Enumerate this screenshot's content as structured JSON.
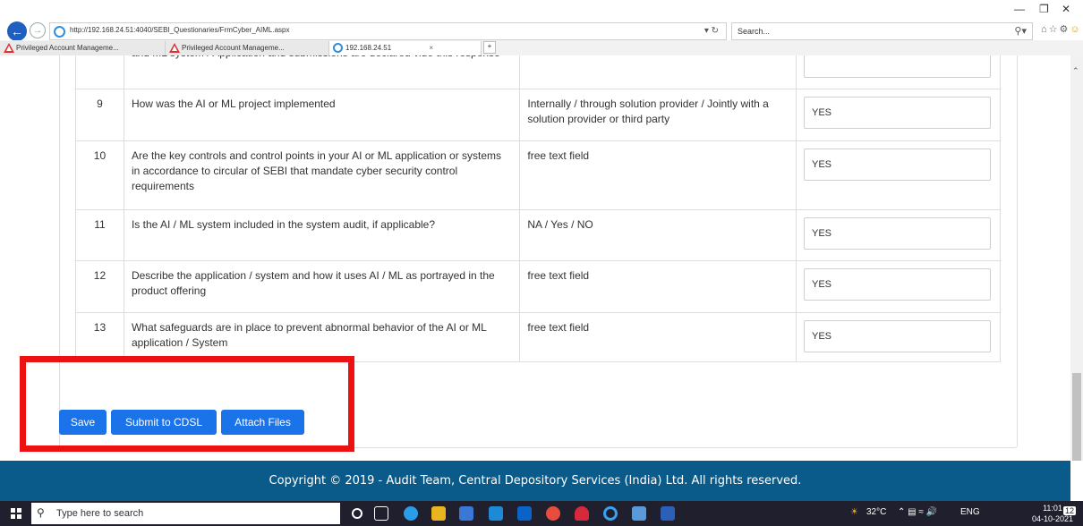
{
  "browser": {
    "url": "http://192.168.24.51:4040/SEBI_Questionaries/FrmCyber_AIML.aspx",
    "search_placeholder": "Search...",
    "tabs": [
      {
        "label": "Privileged Account Manageme..."
      },
      {
        "label": "Privileged Account Manageme..."
      },
      {
        "label": "192.168.24.51"
      }
    ]
  },
  "table": {
    "rows": [
      {
        "num": "",
        "question": "and ML system / Application and submissions are declared vide this response",
        "options": "",
        "answer": ""
      },
      {
        "num": "9",
        "question": "How was the AI or ML project implemented",
        "options": "Internally / through solution provider / Jointly with a solution provider or third party",
        "answer": "YES"
      },
      {
        "num": "10",
        "question": "Are the key controls and control points in your AI or ML application or systems in accordance to circular of SEBI that mandate cyber security control requirements",
        "options": "free text field",
        "answer": "YES"
      },
      {
        "num": "11",
        "question": "Is the AI / ML system included in the system audit, if applicable?",
        "options": "NA / Yes / NO",
        "answer": "YES"
      },
      {
        "num": "12",
        "question": "Describe the application / system and how it uses AI / ML as portrayed in the product offering",
        "options": "free text field",
        "answer": "YES"
      },
      {
        "num": "13",
        "question": "What safeguards are in place to prevent abnormal behavior of the AI or ML application / System",
        "options": "free text field",
        "answer": "YES"
      }
    ]
  },
  "actions": {
    "save": "Save",
    "submit": "Submit to CDSL",
    "attach": "Attach Files"
  },
  "footer": {
    "text": "Copyright © 2019 - Audit Team, Central Depository Services (India) Ltd. All rights reserved."
  },
  "taskbar": {
    "search_placeholder": "Type here to search",
    "weather": "32°C",
    "language": "ENG",
    "time": "11:01",
    "date": "04-10-2021",
    "notifications": "12"
  },
  "colors": {
    "button": "#1a73e8",
    "footer": "#0a5b8a",
    "highlight": "#ee1111"
  }
}
